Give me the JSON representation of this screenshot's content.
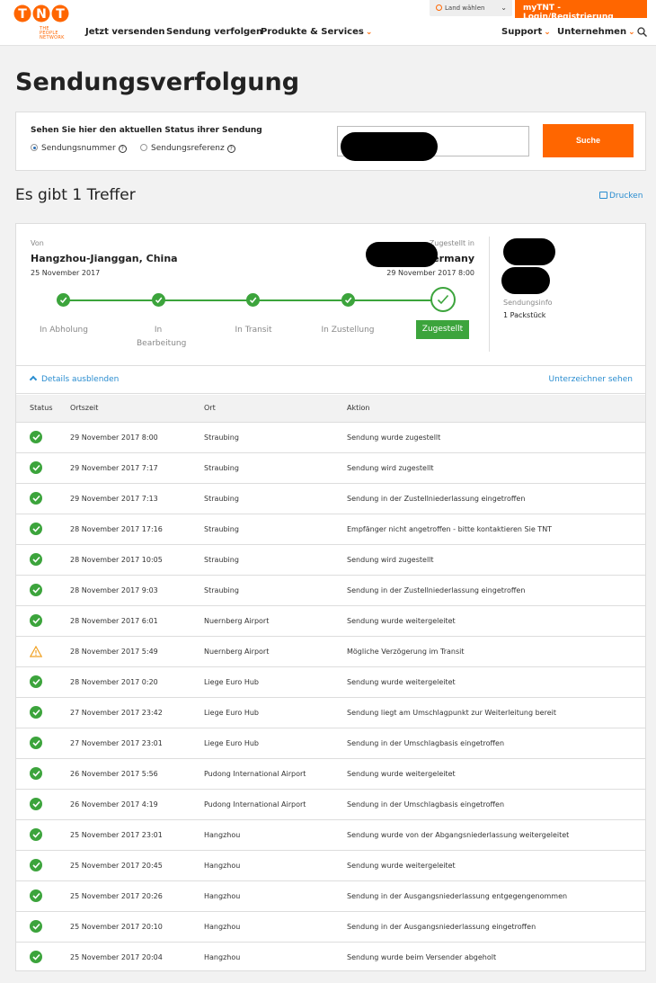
{
  "header": {
    "logo": "TNT",
    "logo_tag_1": "THE PEOPLE",
    "logo_tag_2": "NETWORK",
    "nav_left": [
      "Jetzt versenden",
      "Sendung verfolgen",
      "Produkte & Services"
    ],
    "nav_right": [
      "Support",
      "Unternehmen"
    ],
    "land_label": "Land wählen",
    "login_label": "myTNT -Login/Registrierung",
    "accent_color": "#ff6600"
  },
  "page_title": "Sendungsverfolgung",
  "search": {
    "heading": "Sehen Sie hier den aktuellen Status ihrer Sendung",
    "radio_1": "Sendungsnummer",
    "radio_2": "Sendungsreferenz",
    "help": "?",
    "button": "Suche"
  },
  "results": {
    "heading": "Es gibt 1 Treffer",
    "print": "Drucken"
  },
  "shipment": {
    "from_label": "Von",
    "from_city": "Hangzhou-Jianggan, China",
    "from_date": "25 November 2017",
    "to_label": "Zugestellt in",
    "to_city": "ermany",
    "to_date": "29 November 2017 8:00",
    "info_label": "Sendungsinfo",
    "info_value": "1 Packstück",
    "steps": [
      "In Abholung",
      "In Bearbeitung",
      "In Transit",
      "In Zustellung",
      "Zugestellt"
    ]
  },
  "details": {
    "toggle": "Details ausblenden",
    "signer": "Unterzeichner sehen"
  },
  "table": {
    "headers": [
      "Status",
      "Ortszeit",
      "Ort",
      "Aktion"
    ],
    "rows": [
      {
        "status": "ok",
        "time": "29 November 2017 8:00",
        "place": "Straubing",
        "action": "Sendung wurde zugestellt"
      },
      {
        "status": "ok",
        "time": "29 November 2017 7:17",
        "place": "Straubing",
        "action": "Sendung wird zugestellt"
      },
      {
        "status": "ok",
        "time": "29 November 2017 7:13",
        "place": "Straubing",
        "action": "Sendung in der Zustellniederlassung eingetroffen"
      },
      {
        "status": "ok",
        "time": "28 November 2017 17:16",
        "place": "Straubing",
        "action": "Empfänger nicht angetroffen - bitte kontaktieren Sie TNT"
      },
      {
        "status": "ok",
        "time": "28 November 2017 10:05",
        "place": "Straubing",
        "action": "Sendung wird zugestellt"
      },
      {
        "status": "ok",
        "time": "28 November 2017 9:03",
        "place": "Straubing",
        "action": "Sendung in der Zustellniederlassung eingetroffen"
      },
      {
        "status": "ok",
        "time": "28 November 2017 6:01",
        "place": "Nuernberg Airport",
        "action": "Sendung wurde weitergeleitet"
      },
      {
        "status": "warn",
        "time": "28 November 2017 5:49",
        "place": "Nuernberg Airport",
        "action": "Mögliche Verzögerung im Transit"
      },
      {
        "status": "ok",
        "time": "28 November 2017 0:20",
        "place": "Liege Euro Hub",
        "action": "Sendung wurde weitergeleitet"
      },
      {
        "status": "ok",
        "time": "27 November 2017 23:42",
        "place": "Liege Euro Hub",
        "action": "Sendung liegt am Umschlagpunkt zur Weiterleitung bereit"
      },
      {
        "status": "ok",
        "time": "27 November 2017 23:01",
        "place": "Liege Euro Hub",
        "action": "Sendung in der Umschlagbasis eingetroffen"
      },
      {
        "status": "ok",
        "time": "26 November 2017 5:56",
        "place": "Pudong International Airport",
        "action": "Sendung wurde weitergeleitet"
      },
      {
        "status": "ok",
        "time": "26 November 2017 4:19",
        "place": "Pudong International Airport",
        "action": "Sendung in der Umschlagbasis eingetroffen"
      },
      {
        "status": "ok",
        "time": "25 November 2017 23:01",
        "place": "Hangzhou",
        "action": "Sendung wurde von der Abgangsniederlassung weitergeleitet"
      },
      {
        "status": "ok",
        "time": "25 November 2017 20:45",
        "place": "Hangzhou",
        "action": "Sendung wurde weitergeleitet"
      },
      {
        "status": "ok",
        "time": "25 November 2017 20:26",
        "place": "Hangzhou",
        "action": "Sendung in der Ausgangsniederlassung entgegengenommen"
      },
      {
        "status": "ok",
        "time": "25 November 2017 20:10",
        "place": "Hangzhou",
        "action": "Sendung in der Ausgangsniederlassung eingetroffen"
      },
      {
        "status": "ok",
        "time": "25 November 2017 20:04",
        "place": "Hangzhou",
        "action": "Sendung wurde beim Versender abgeholt"
      }
    ]
  }
}
